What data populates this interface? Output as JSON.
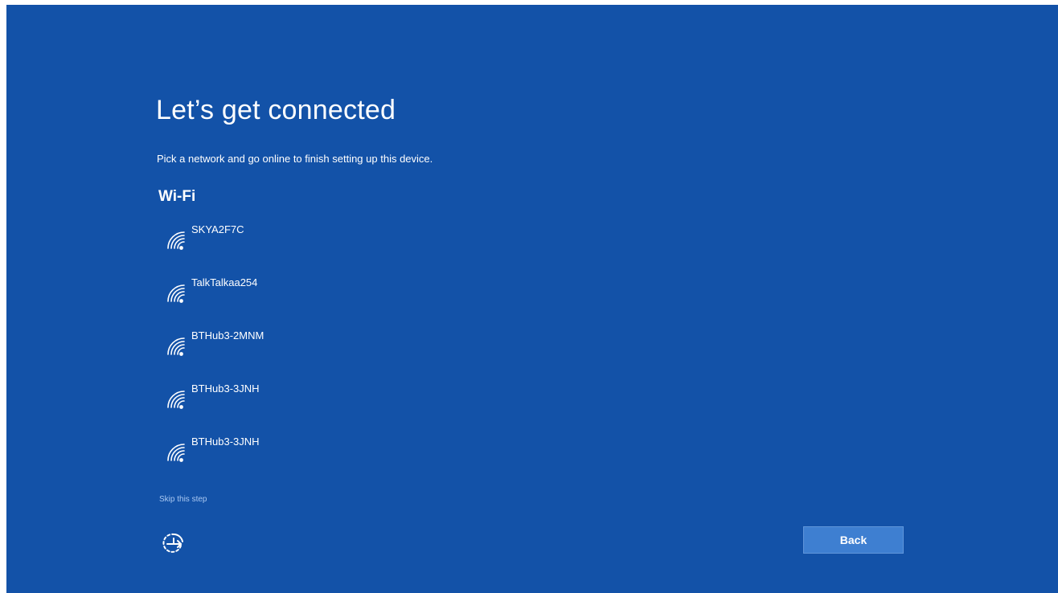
{
  "header": {
    "title": "Let’s get connected",
    "subtitle": "Pick a network and go online to finish setting up this device."
  },
  "wifi": {
    "heading": "Wi-Fi",
    "networks": [
      {
        "name": "SKYA2F7C",
        "icon": "wifi-secured-icon"
      },
      {
        "name": "TalkTalkaa254",
        "icon": "wifi-secured-icon"
      },
      {
        "name": "BTHub3-2MNM",
        "icon": "wifi-secured-icon"
      },
      {
        "name": "BTHub3-3JNH",
        "icon": "wifi-secured-icon"
      },
      {
        "name": "BTHub3-3JNH",
        "icon": "wifi-secured-icon"
      }
    ]
  },
  "footer": {
    "skip_label": "Skip this step",
    "ease_of_access_icon": "ease-of-access-icon",
    "back_label": "Back"
  },
  "colors": {
    "background": "#1352a8",
    "button": "#3e7fd1",
    "link": "#a9c8f2",
    "text": "#ffffff"
  }
}
